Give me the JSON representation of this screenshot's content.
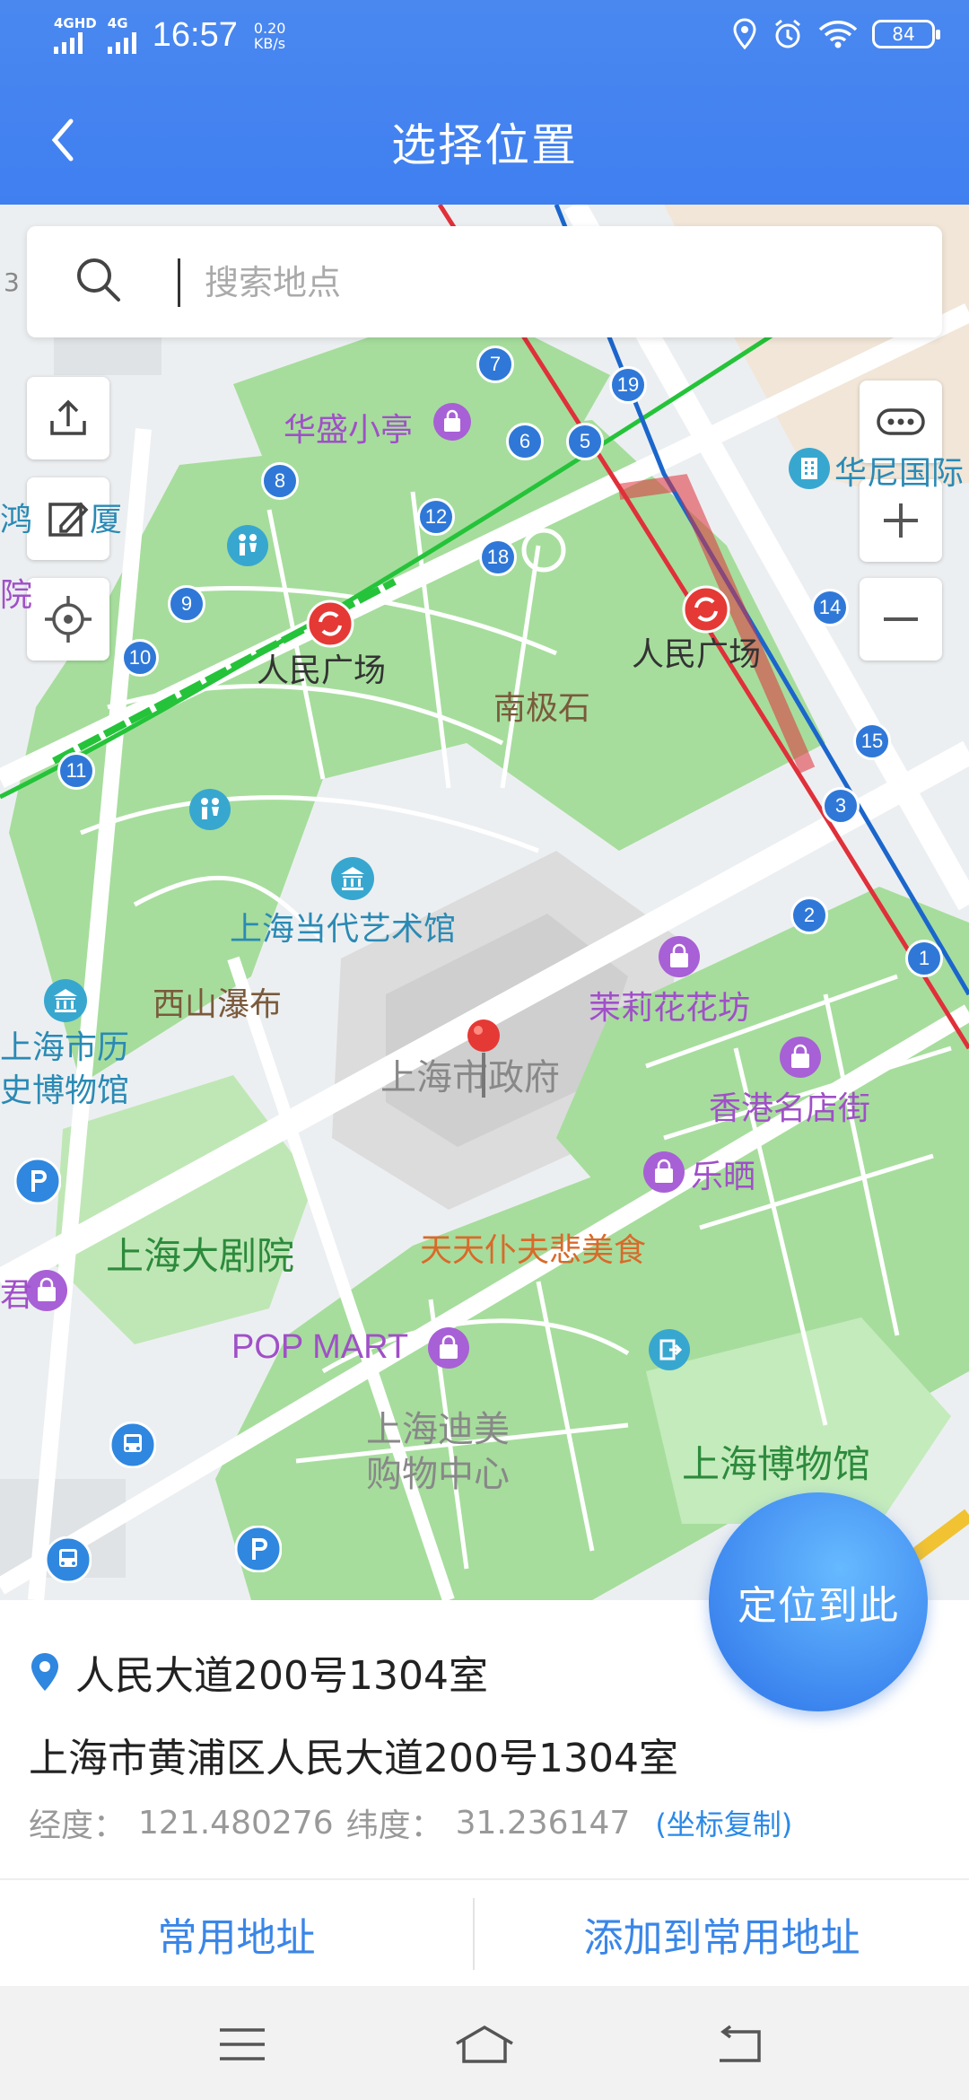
{
  "status_bar": {
    "signal1": "4GHD",
    "signal2": "4G",
    "time": "16:57",
    "speed_value": "0.20",
    "speed_unit": "KB/s",
    "battery": "84"
  },
  "header": {
    "title": "选择位置"
  },
  "search": {
    "placeholder": "搜索地点"
  },
  "map": {
    "labels": {
      "huasheng": "华盛小亭",
      "renmin_left": "人民广场",
      "renmin_right": "人民广场",
      "nanjishi": "南极石",
      "contemporary": "上海当代艺术馆",
      "xishan": "西山瀑布",
      "history1": "上海市历",
      "history2": "史博物馆",
      "gov": "上海市政府",
      "moli": "茉莉花花坊",
      "hk": "香港名店街",
      "lesai": "乐晒",
      "theatre": "上海大剧院",
      "tiantian": "天天仆夫悲美食",
      "popmart": "POP MART",
      "dimei1": "上海迪美",
      "dimei2": "购物中心",
      "museum": "上海博物馆",
      "huachen": "华尼国际",
      "hehe": "鸿",
      "xia": "厦",
      "yuan": "院",
      "jun": "君",
      "edge3": "3"
    },
    "exits": [
      "7",
      "19",
      "6",
      "5",
      "8",
      "12",
      "18",
      "9",
      "10",
      "11",
      "14",
      "15",
      "3",
      "2",
      "1"
    ]
  },
  "locate_button": "定位到此",
  "location": {
    "name": "人民大道200号1304室",
    "address": "上海市黄浦区人民大道200号1304室",
    "lng_label": "经度：",
    "lng": "121.480276",
    "lat_label": "纬度：",
    "lat": "31.236147",
    "copy": "(坐标复制)"
  },
  "actions": {
    "common": "常用地址",
    "add_common": "添加到常用地址"
  },
  "colors": {
    "header": "#3f7ff0",
    "park": "#a6dd9c",
    "accent": "#2a8ae8",
    "line2": "#25c33a",
    "line1": "#e0303a",
    "line8": "#1b66cc"
  }
}
